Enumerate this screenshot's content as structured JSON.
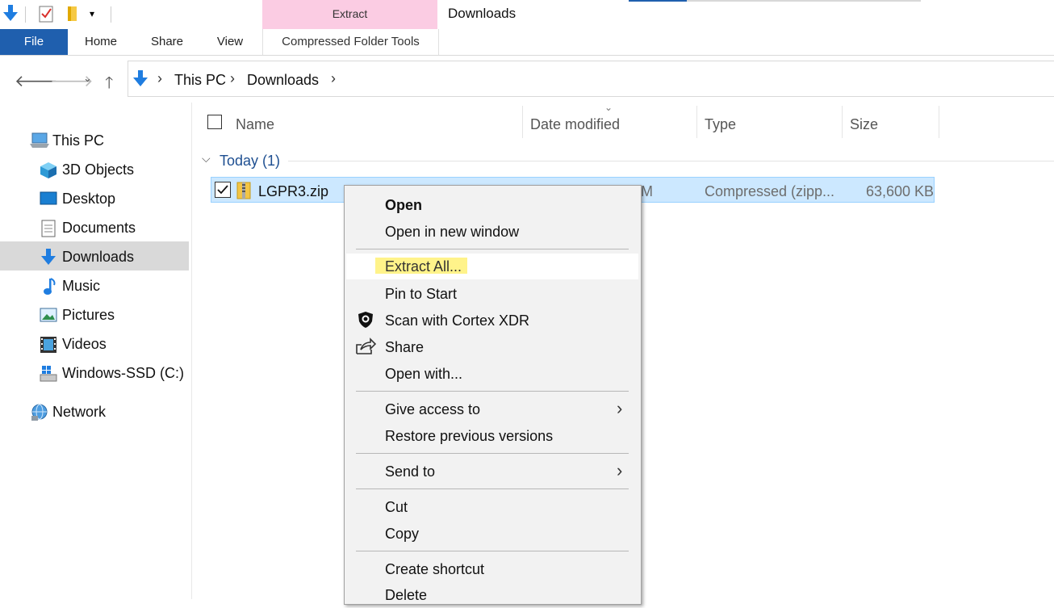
{
  "ribbon": {
    "file_tab": "File",
    "home_tab": "Home",
    "share_tab": "Share",
    "view_tab": "View",
    "context_header": "Extract",
    "context_tab": "Compressed Folder Tools"
  },
  "window": {
    "title": "Downloads"
  },
  "breadcrumb": [
    "This PC",
    "Downloads"
  ],
  "nav_pane": {
    "items": [
      {
        "label": "This PC",
        "icon": "computer-icon"
      },
      {
        "label": "3D Objects",
        "icon": "cube-icon"
      },
      {
        "label": "Desktop",
        "icon": "desktop-icon"
      },
      {
        "label": "Documents",
        "icon": "document-icon"
      },
      {
        "label": "Downloads",
        "icon": "download-arrow-icon",
        "selected": true
      },
      {
        "label": "Music",
        "icon": "music-note-icon"
      },
      {
        "label": "Pictures",
        "icon": "picture-icon"
      },
      {
        "label": "Videos",
        "icon": "film-icon"
      },
      {
        "label": "Windows-SSD (C:)",
        "icon": "drive-icon"
      },
      {
        "label": "Network",
        "icon": "network-icon"
      }
    ]
  },
  "columns": {
    "name": "Name",
    "date_modified": "Date modified",
    "type": "Type",
    "size": "Size"
  },
  "group": {
    "label": "Today (1)"
  },
  "file": {
    "name": "LGPR3.zip",
    "date_fragment": "M",
    "type": "Compressed (zipp...",
    "size": "63,600 KB",
    "checked": true
  },
  "context_menu": {
    "open": "Open",
    "open_new_window": "Open in new window",
    "extract_all": "Extract All...",
    "pin_to_start": "Pin to Start",
    "scan_cortex": "Scan with Cortex XDR",
    "share": "Share",
    "open_with": "Open with...",
    "give_access": "Give access to",
    "restore_versions": "Restore previous versions",
    "send_to": "Send to",
    "cut": "Cut",
    "copy": "Copy",
    "create_shortcut": "Create shortcut",
    "delete": "Delete"
  },
  "colors": {
    "file_tab": "#1f5fae",
    "context_tab_header": "#fbcce3",
    "selection": "#cce8ff",
    "highlight": "#fff38a"
  }
}
